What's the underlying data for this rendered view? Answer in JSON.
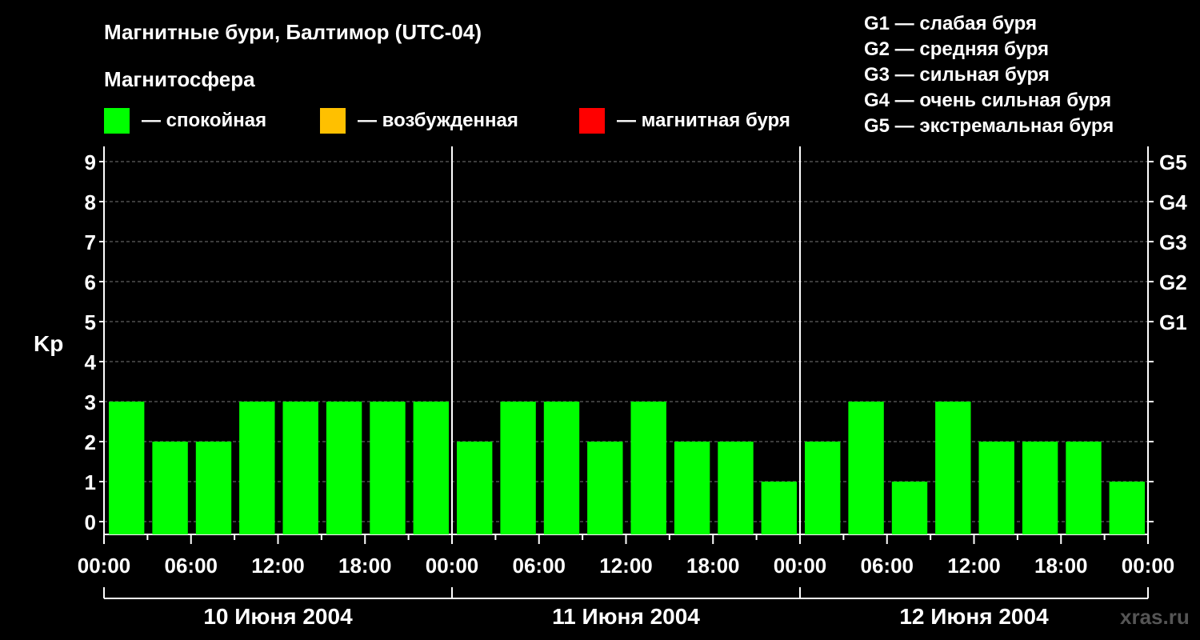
{
  "chart_data": {
    "type": "bar",
    "title": "Магнитные бури, Балтимор (UTC-04)",
    "legend_title": "Магнитосфера",
    "legend": [
      {
        "label": "— спокойная",
        "color": "#00ff00"
      },
      {
        "label": "— возбужденная",
        "color": "#ffc000"
      },
      {
        "label": "— магнитная буря",
        "color": "#ff0000"
      }
    ],
    "storm_scale": [
      "G1 — слабая буря",
      "G2 — средняя буря",
      "G3 — сильная буря",
      "G4 — очень сильная буря",
      "G5 — экстремальная буря"
    ],
    "ylabel": "Kp",
    "ylim": [
      0,
      9
    ],
    "yticks": [
      "0",
      "1",
      "2",
      "3",
      "4",
      "5",
      "6",
      "7",
      "8",
      "9"
    ],
    "right_ticks": [
      {
        "kp": 5,
        "label": "G1"
      },
      {
        "kp": 6,
        "label": "G2"
      },
      {
        "kp": 7,
        "label": "G3"
      },
      {
        "kp": 8,
        "label": "G4"
      },
      {
        "kp": 9,
        "label": "G5"
      }
    ],
    "x_tick_labels": [
      "00:00",
      "06:00",
      "12:00",
      "18:00",
      "00:00",
      "06:00",
      "12:00",
      "18:00",
      "00:00",
      "06:00",
      "12:00",
      "18:00",
      "00:00"
    ],
    "days": [
      "10 Июня 2004",
      "11 Июня 2004",
      "12 Июня 2004"
    ],
    "interval_hours": 3,
    "values": [
      3,
      2,
      2,
      3,
      3,
      3,
      3,
      3,
      2,
      3,
      3,
      2,
      3,
      2,
      2,
      1,
      2,
      3,
      1,
      3,
      2,
      2,
      2,
      1
    ],
    "grid": "dashed horizontal at each Kp"
  },
  "watermark": "xras.ru"
}
